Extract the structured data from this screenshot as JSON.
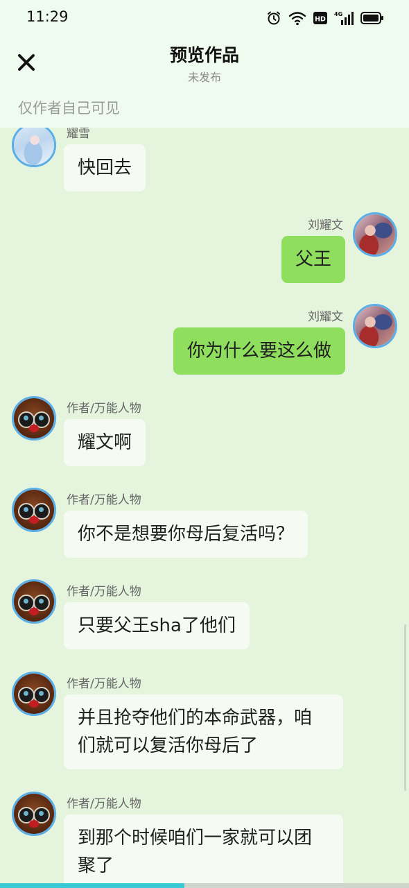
{
  "status_bar": {
    "time": "11:29",
    "network_label": "4G",
    "hd_label": "HD"
  },
  "header": {
    "title": "预览作品",
    "subtitle": "未发布",
    "visibility_note": "仅作者自己可见"
  },
  "messages": [
    {
      "side": "left",
      "avatar": "female-avatar",
      "name": "耀雪",
      "text": "快回去"
    },
    {
      "side": "right",
      "avatar": "male-avatar",
      "name": "刘耀文",
      "text": "父王"
    },
    {
      "side": "right",
      "avatar": "male-avatar",
      "name": "刘耀文",
      "text": "你为什么要这么做"
    },
    {
      "side": "left",
      "avatar": "owl-avatar",
      "name": "作者/万能人物",
      "text": "耀文啊"
    },
    {
      "side": "left",
      "avatar": "owl-avatar",
      "name": "作者/万能人物",
      "text": "你不是想要你母后复活吗？"
    },
    {
      "side": "left",
      "avatar": "owl-avatar",
      "name": "作者/万能人物",
      "text": "只要父王sha了他们"
    },
    {
      "side": "left",
      "avatar": "owl-avatar",
      "name": "作者/万能人物",
      "text": "并且抢夺他们的本命武器，咱们就可以复活你母后了"
    },
    {
      "side": "left",
      "avatar": "owl-avatar",
      "name": "作者/万能人物",
      "text": "到那个时候咱们一家就可以团聚了"
    }
  ],
  "colors": {
    "page_background": "#e4f4dd",
    "header_background": "#effbef",
    "own_bubble": "#8fde5d",
    "other_bubble": "#f5fbf2",
    "avatar_ring": "#5aaee8",
    "progress_accent": "#3cc9d6"
  },
  "icons": {
    "close": "close-icon",
    "alarm": "alarm-icon",
    "wifi": "wifi-icon",
    "hd": "hd-icon",
    "signal": "signal-4g-icon",
    "battery": "battery-icon"
  },
  "playback_progress": 0.45
}
